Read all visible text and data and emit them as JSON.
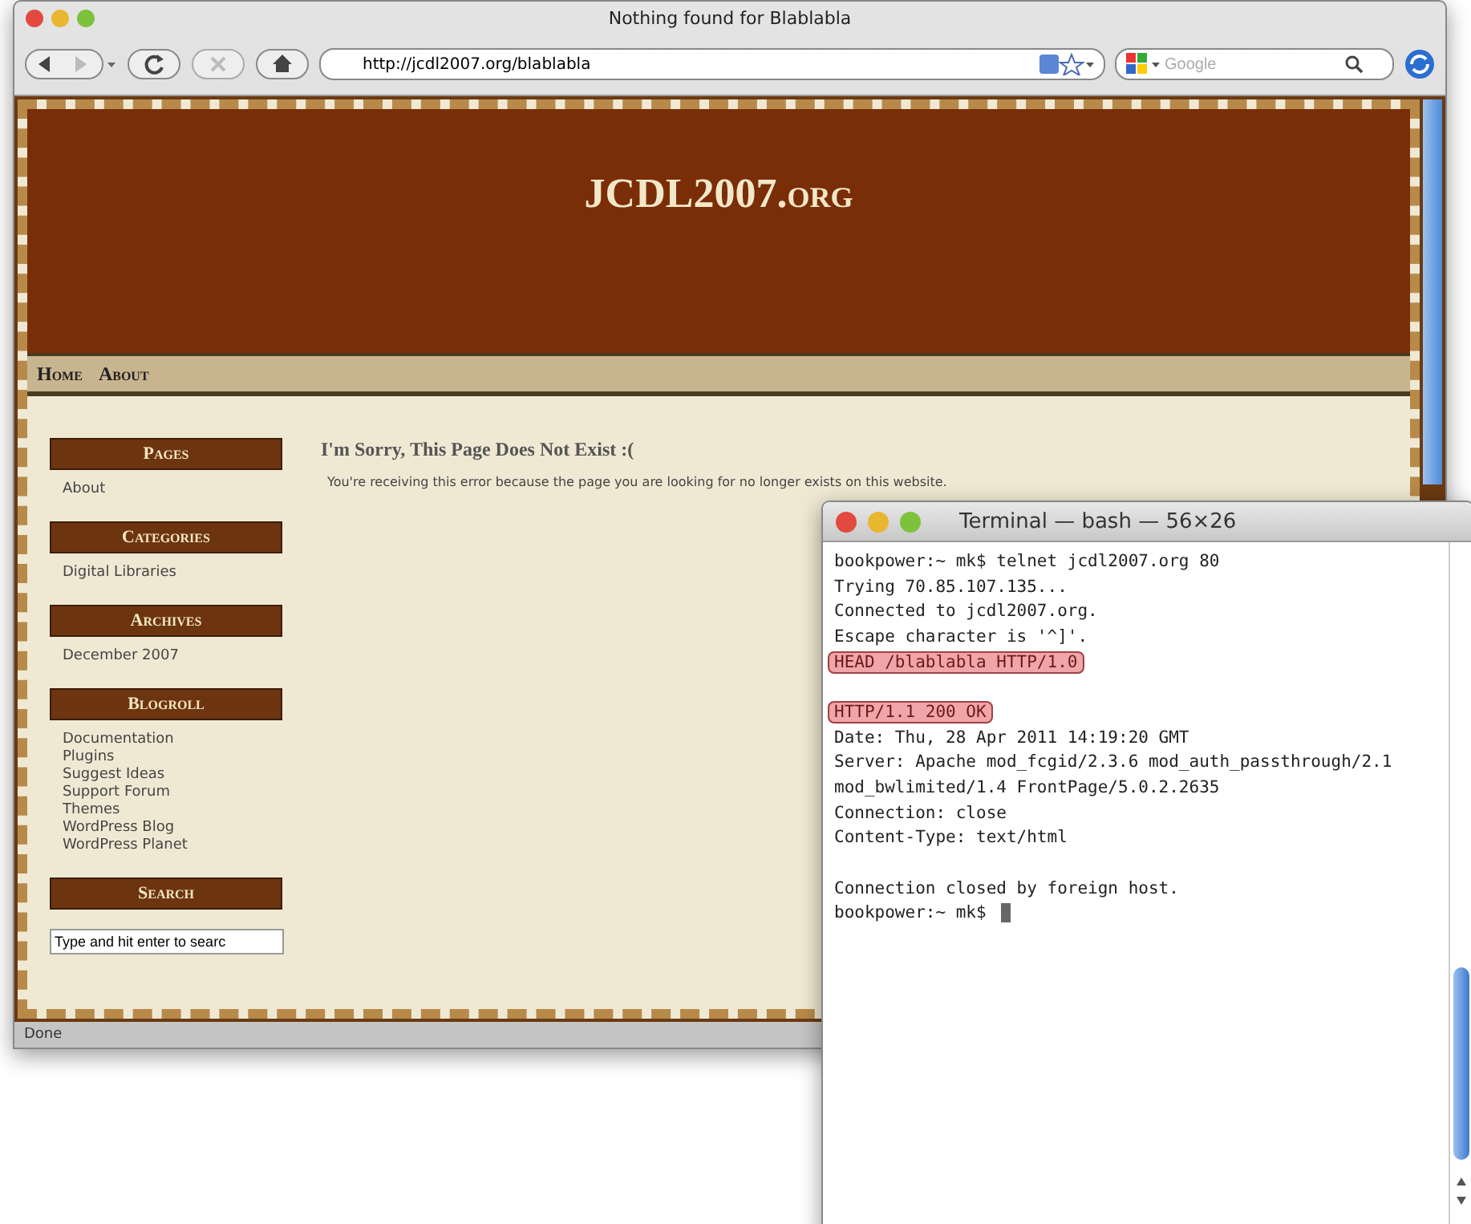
{
  "browser": {
    "title": "Nothing found for Blablabla",
    "url": "http://jcdl2007.org/blablabla",
    "search_placeholder": "Google",
    "status": "Done"
  },
  "site": {
    "title": "JCDL2007.org",
    "nav": [
      "Home",
      "About"
    ],
    "sidebar": [
      {
        "heading": "Pages",
        "links": [
          "About"
        ]
      },
      {
        "heading": "Categories",
        "links": [
          "Digital Libraries"
        ]
      },
      {
        "heading": "Archives",
        "links": [
          "December 2007"
        ]
      },
      {
        "heading": "Blogroll",
        "links": [
          "Documentation",
          "Plugins",
          "Suggest Ideas",
          "Support Forum",
          "Themes",
          "WordPress Blog",
          "WordPress Planet"
        ]
      },
      {
        "heading": "Search"
      }
    ],
    "search_value": "Type and hit enter to searc",
    "error_title": "I'm Sorry, This Page Does Not Exist :(",
    "error_text": "You're receiving this error because the page you are looking for no longer exists on this website."
  },
  "terminal": {
    "title": "Terminal — bash — 56×26",
    "blocks": [
      {
        "lines": [
          {
            "text": "bookpower:~ mk$ telnet jcdl2007.org 80",
            "highlighted": false
          },
          {
            "text": "Trying 70.85.107.135...",
            "highlighted": false
          },
          {
            "text": "Connected to jcdl2007.org.",
            "highlighted": false
          },
          {
            "text": "Escape character is '^]'.",
            "highlighted": false
          },
          {
            "text": "HEAD /blablabla HTTP/1.0",
            "highlighted": true
          }
        ]
      },
      {
        "lines": [
          {
            "text": "HTTP/1.1 200 OK",
            "highlighted": true
          },
          {
            "text": "Date: Thu, 28 Apr 2011 14:19:20 GMT",
            "highlighted": false
          },
          {
            "text": "Server: Apache mod_fcgid/2.3.6 mod_auth_passthrough/2.1",
            "highlighted": false
          },
          {
            "text": "mod_bwlimited/1.4 FrontPage/5.0.2.2635",
            "highlighted": false
          },
          {
            "text": "Connection: close",
            "highlighted": false
          },
          {
            "text": "Content-Type: text/html",
            "highlighted": false
          }
        ]
      },
      {
        "lines": [
          {
            "text": "Connection closed by foreign host.",
            "highlighted": false
          },
          {
            "text": "bookpower:~ mk$",
            "highlighted": false,
            "cursor": true
          }
        ]
      }
    ]
  }
}
